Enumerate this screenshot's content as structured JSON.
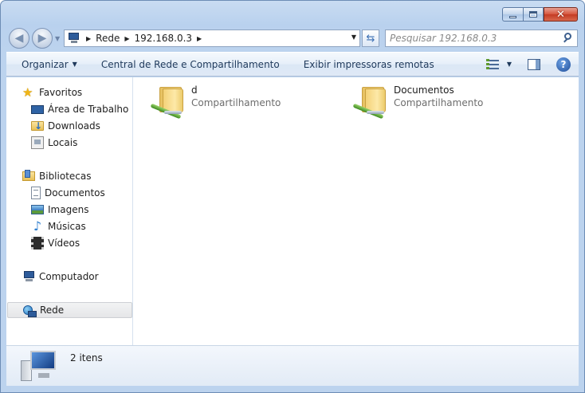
{
  "window": {
    "close_glyph": "✕"
  },
  "address": {
    "segments": [
      "Rede",
      "192.168.0.3"
    ]
  },
  "search": {
    "placeholder": "Pesquisar 192.168.0.3"
  },
  "toolbar": {
    "organize": "Organizar",
    "network_center": "Central de Rede e Compartilhamento",
    "remote_printers": "Exibir impressoras remotas"
  },
  "navpane": {
    "favorites": "Favoritos",
    "desktop": "Área de Trabalho",
    "downloads": "Downloads",
    "places": "Locais",
    "libraries": "Bibliotecas",
    "documents": "Documentos",
    "images": "Imagens",
    "music": "Músicas",
    "videos": "Vídeos",
    "computer": "Computador",
    "network": "Rede"
  },
  "files": [
    {
      "name": "d",
      "type": "Compartilhamento"
    },
    {
      "name": "Documentos",
      "type": "Compartilhamento"
    }
  ],
  "details": {
    "count": "2 itens"
  },
  "icons": {
    "favorites": "star-icon",
    "desktop": "desktop-icon",
    "downloads": "downloads-folder-icon",
    "places": "recent-places-icon",
    "libraries": "libraries-icon",
    "documents": "document-icon",
    "images": "pictures-icon",
    "music": "music-note-icon",
    "videos": "film-icon",
    "computer": "computer-icon",
    "network": "network-globe-icon",
    "share": "shared-folder-icon"
  },
  "colors": {
    "accent": "#1e395b",
    "selection": "#e5e6e8",
    "close": "#c43b24"
  }
}
